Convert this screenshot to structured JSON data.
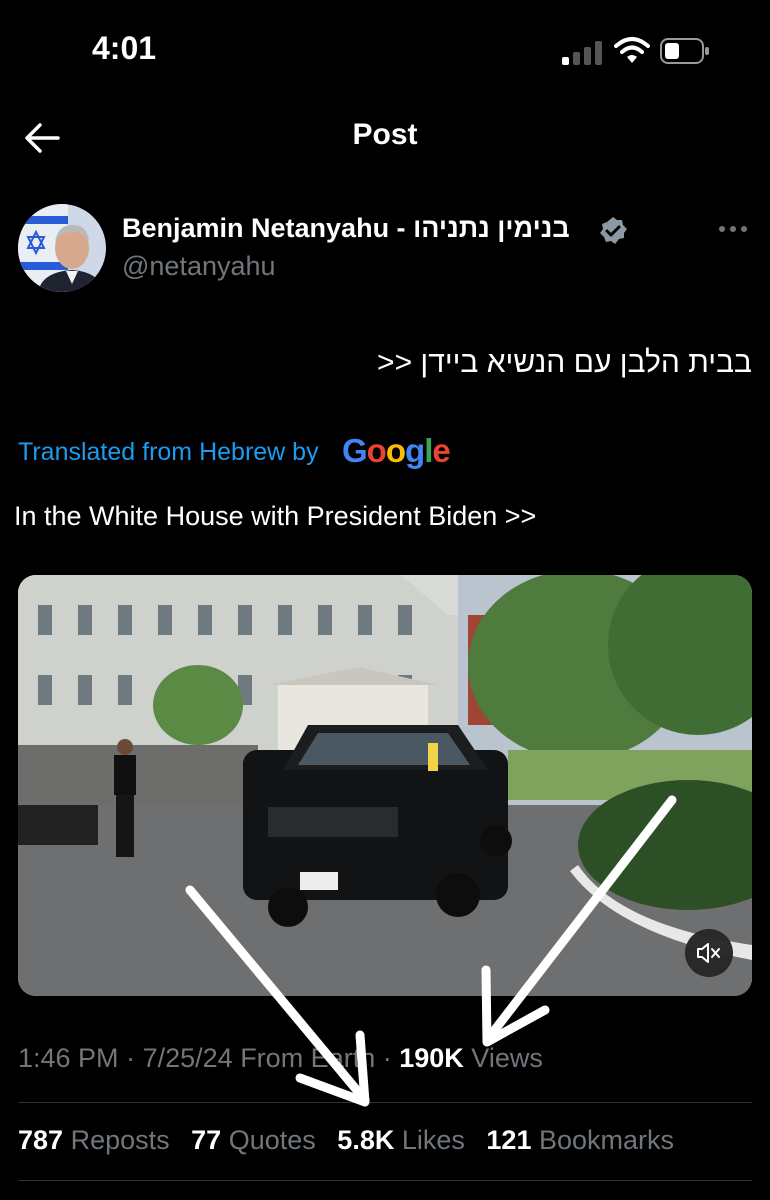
{
  "status_bar": {
    "time": "4:01"
  },
  "header": {
    "title": "Post"
  },
  "author": {
    "name": "Benjamin Netanyahu - בנימין נתניהו",
    "handle": "@netanyahu"
  },
  "post": {
    "original_text": "בבית הלבן עם הנשיא ביידן <<",
    "translated_label": "Translated from Hebrew by",
    "translator_logo": "Google",
    "translated_text": "In the White House with President Biden >>"
  },
  "meta": {
    "time": "1:46 PM",
    "date": "7/25/24",
    "location": "From Earth",
    "views_count": "190K",
    "views_label": "Views"
  },
  "stats": [
    {
      "count": "787",
      "label": "Reposts"
    },
    {
      "count": "77",
      "label": "Quotes"
    },
    {
      "count": "5.8K",
      "label": "Likes"
    },
    {
      "count": "121",
      "label": "Bookmarks"
    }
  ],
  "icons": {
    "back": "arrow-left-icon",
    "verified": "verified-badge-icon",
    "more": "more-icon",
    "mute": "muted-speaker-icon"
  },
  "colors": {
    "background": "#000000",
    "link": "#1d9bf0",
    "secondary_text": "#71767b",
    "divider": "#2f3336"
  }
}
